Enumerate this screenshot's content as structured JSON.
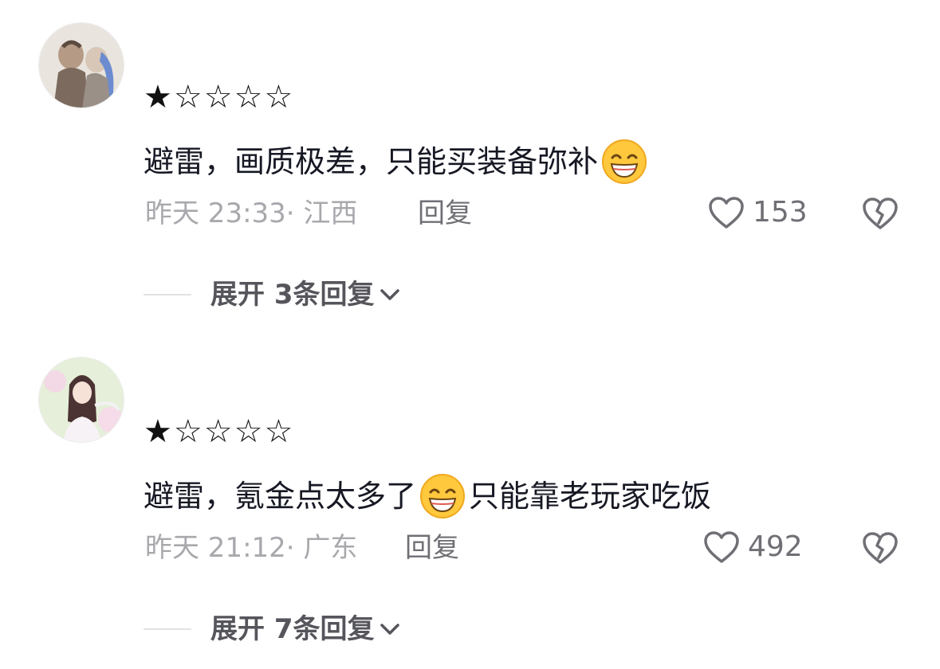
{
  "comments": [
    {
      "rating_stars": "★☆☆☆☆",
      "text_part1": "避雷，画质极差，只能买装备弥补",
      "text_part2": "",
      "time": "昨天 23:33",
      "location": "江西",
      "reply_label": "回复",
      "like_count": "153",
      "expand_label": "展开 3条回复"
    },
    {
      "rating_stars": "★☆☆☆☆",
      "text_part1": "避雷，氪金点太多了",
      "text_part2": "只能靠老玩家吃饭",
      "time": "昨天 21:12",
      "location": "广东",
      "reply_label": "回复",
      "like_count": "492",
      "expand_label": "展开 7条回复"
    }
  ],
  "icons": {
    "emoji": "grinning-sweat-emoji",
    "like": "heart-outline-icon",
    "dislike": "broken-heart-icon",
    "expand": "chevron-down-icon"
  },
  "colors": {
    "text": "#161823",
    "meta": "#a8a8ad",
    "action": "#6f6f75",
    "emoji_face": "#ffc83d"
  }
}
